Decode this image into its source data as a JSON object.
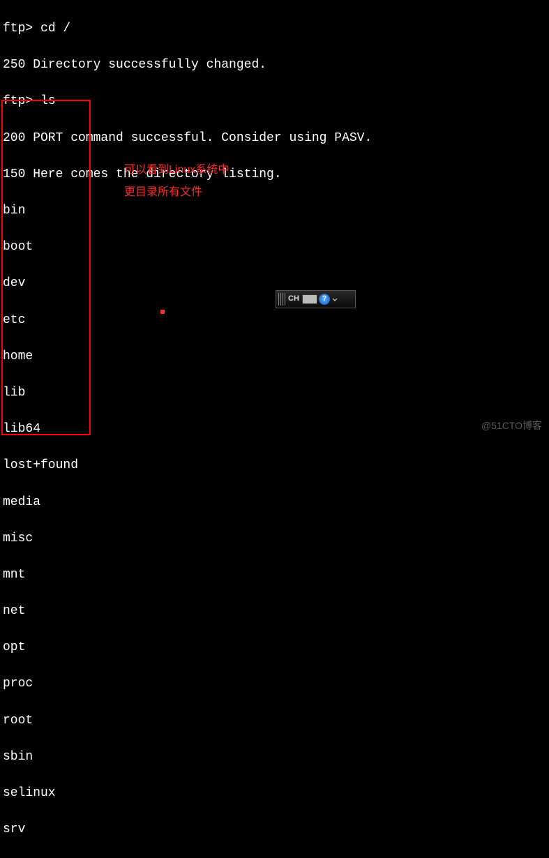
{
  "terminal": {
    "prompt1": "ftp> ",
    "cmd1": "cd /",
    "resp1": "250 Directory successfully changed.",
    "prompt2": "ftp> ",
    "cmd2": "ls",
    "resp2a": "200 PORT command successful. Consider using PASV.",
    "resp2b": "150 Here comes the directory listing.",
    "listing": [
      "bin",
      "boot",
      "dev",
      "etc",
      "home",
      "lib",
      "lib64",
      "lost+found",
      "media",
      "misc",
      "mnt",
      "net",
      "opt",
      "proc",
      "root",
      "sbin",
      "selinux",
      "srv"
    ]
  },
  "annotation": {
    "line1": "可以看到Linux系统中",
    "line2": "更目录所有文件"
  },
  "ime": {
    "label": "CH",
    "help": "?"
  },
  "watermark": "@51CTO博客"
}
